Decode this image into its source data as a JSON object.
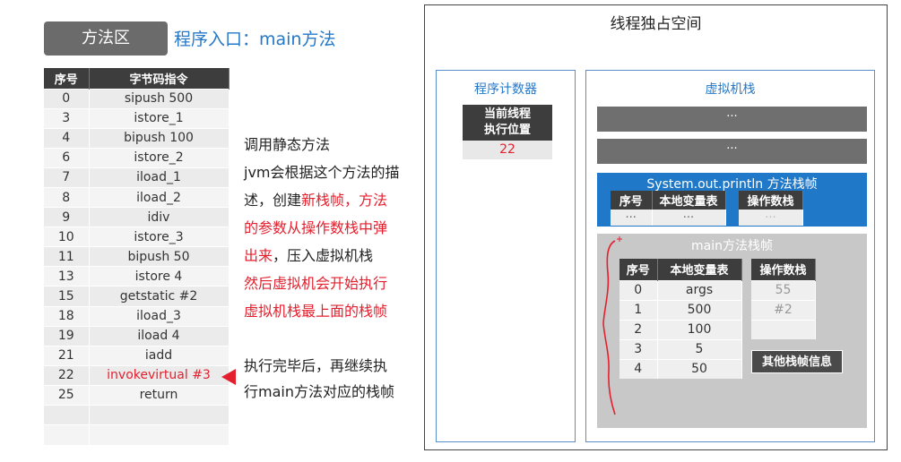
{
  "method_area": {
    "tag": "方法区",
    "entry_title": "程序入口：main方法",
    "columns": [
      "序号",
      "字节码指令"
    ],
    "rows": [
      [
        "0",
        "sipush 500"
      ],
      [
        "3",
        "istore_1"
      ],
      [
        "4",
        "bipush 100"
      ],
      [
        "6",
        "istore_2"
      ],
      [
        "7",
        "iload_1"
      ],
      [
        "8",
        "iload_2"
      ],
      [
        "9",
        "idiv"
      ],
      [
        "10",
        "istore_3"
      ],
      [
        "11",
        "bipush 50"
      ],
      [
        "13",
        "istore 4"
      ],
      [
        "15",
        "getstatic #2"
      ],
      [
        "18",
        "iload_3"
      ],
      [
        "19",
        "iload 4"
      ],
      [
        "21",
        "iadd"
      ],
      [
        "22",
        "invokevirtual #3"
      ],
      [
        "25",
        "return"
      ],
      [
        "",
        ""
      ],
      [
        "",
        ""
      ]
    ],
    "highlight_row": 14
  },
  "explanation": {
    "line1": "调用静态方法",
    "line2": "jvm会根据这个方法的描",
    "line3_prefix": "述，创建",
    "line3_red": "新栈帧，方法",
    "line4_red": "的参数从操作数栈中弹",
    "line5_red": "出来",
    "line5_rest": "，压入虚拟机栈",
    "line6_red": "然后虚拟机会开始执行",
    "line7_red": "虚拟机栈最上面的栈帧",
    "after_line1": "执行完毕后，再继续执",
    "after_line2": "行main方法对应的栈帧"
  },
  "thread_space": {
    "title": "线程独占空间",
    "program_counter": {
      "title": "程序计数器",
      "header_line1": "当前线程",
      "header_line2": "执行位置",
      "value": "22"
    },
    "vm_stack": {
      "title": "虚拟机栈",
      "bar1": "···",
      "bar2": "···",
      "println_frame": {
        "title": "System.out.println 方法栈帧",
        "locals_columns": [
          "序号",
          "本地变量表"
        ],
        "locals_row": [
          "···",
          "···"
        ],
        "operand_header": "操作数栈",
        "operand_row": "···"
      },
      "main_frame": {
        "title": "main方法栈帧",
        "locals_columns": [
          "序号",
          "本地变量表"
        ],
        "locals_rows": [
          [
            "0",
            "args"
          ],
          [
            "1",
            "500"
          ],
          [
            "2",
            "100"
          ],
          [
            "3",
            "5"
          ],
          [
            "4",
            "50"
          ]
        ],
        "operand_header": "操作数栈",
        "operand_rows": [
          "55",
          "#2",
          ""
        ],
        "other_info": "其他栈帧信息"
      }
    }
  },
  "colors": {
    "accent_blue": "#2478c7",
    "frame_blue": "#1f78c8",
    "highlight_red": "#e5202e",
    "header_dark": "#3d3d3d"
  }
}
